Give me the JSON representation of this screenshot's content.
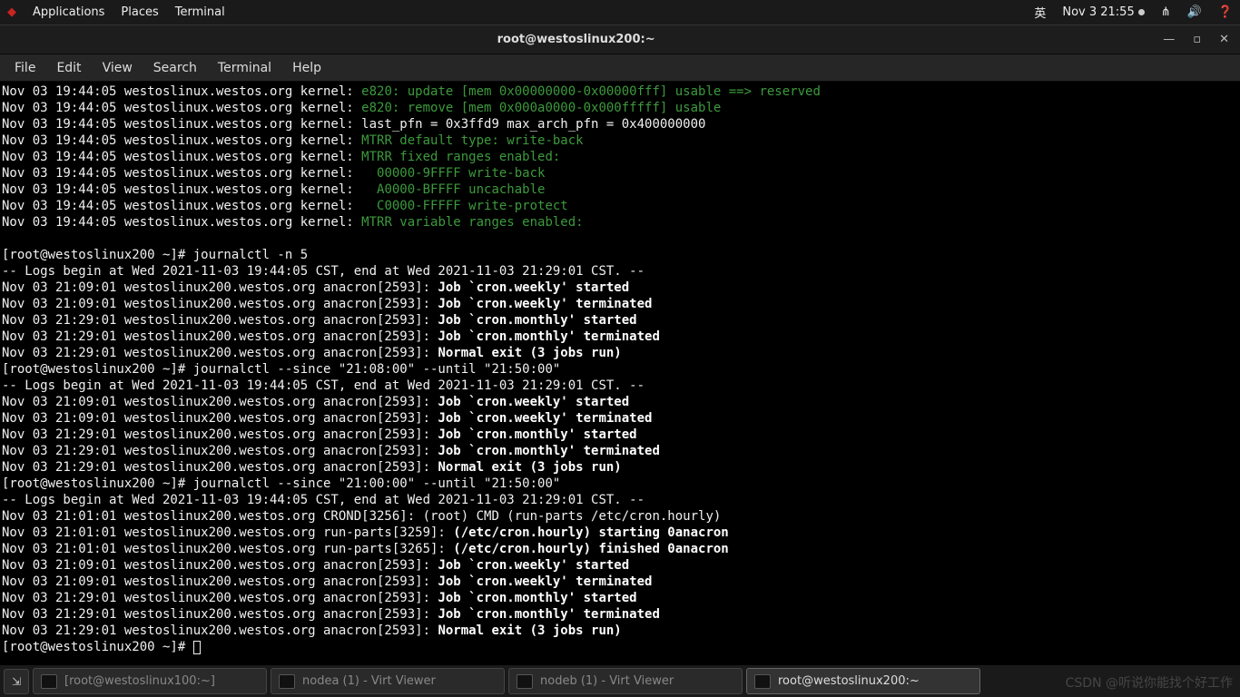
{
  "topbar": {
    "apps": "Applications",
    "places": "Places",
    "terminal": "Terminal",
    "ime": "英",
    "clock": "Nov 3  21:55"
  },
  "window": {
    "title": "root@westoslinux200:~"
  },
  "menu": {
    "file": "File",
    "edit": "Edit",
    "view": "View",
    "search": "Search",
    "terminal": "Terminal",
    "help": "Help"
  },
  "term": {
    "k_prefix": "Nov 03 19:44:05 westoslinux.westos.org kernel: ",
    "k1": "e820: update [mem 0x00000000-0x00000fff] usable ==> reserved",
    "k2": "e820: remove [mem 0x000a0000-0x000fffff] usable",
    "k3_full": "Nov 03 19:44:05 westoslinux.westos.org kernel: last_pfn = 0x3ffd9 max_arch_pfn = 0x400000000",
    "k4": "MTRR default type: write-back",
    "k5": "MTRR fixed ranges enabled:",
    "k6": "  00000-9FFFF write-back",
    "k7": "  A0000-BFFFF uncachable",
    "k8": "  C0000-FFFFF write-protect",
    "k9": "MTRR variable ranges enabled:",
    "blank": "",
    "prompt1": "[root@westoslinux200 ~]# journalctl -n 5",
    "logs_hdr": "-- Logs begin at Wed 2021-11-03 19:44:05 CST, end at Wed 2021-11-03 21:29:01 CST. --",
    "a_prefix_0901": "Nov 03 21:09:01 westoslinux200.westos.org anacron[2593]: ",
    "a_prefix_2901": "Nov 03 21:29:01 westoslinux200.westos.org anacron[2593]: ",
    "a_prefix_0101": "Nov 03 21:01:01 westoslinux200.westos.org ",
    "b_weekly_start": "Job `cron.weekly' started",
    "b_weekly_term": "Job `cron.weekly' terminated",
    "b_monthly_start": "Job `cron.monthly' started",
    "b_monthly_term": "Job `cron.monthly' terminated",
    "b_normal_exit": "Normal exit (3 jobs run)",
    "prompt2": "[root@westoslinux200 ~]# journalctl --since \"21:08:00\" --until \"21:50:00\"",
    "prompt3": "[root@westoslinux200 ~]# journalctl --since \"21:00:00\" --until \"21:50:00\"",
    "crond_line": "Nov 03 21:01:01 westoslinux200.westos.org CROND[3256]: (root) CMD (run-parts /etc/cron.hourly)",
    "rp_start_pre": "Nov 03 21:01:01 westoslinux200.westos.org run-parts[3259]: ",
    "rp_start_b": "(/etc/cron.hourly) starting 0anacron",
    "rp_fin_pre": "Nov 03 21:01:01 westoslinux200.westos.org run-parts[3265]: ",
    "rp_fin_b": "(/etc/cron.hourly) finished 0anacron",
    "prompt_empty": "[root@westoslinux200 ~]# "
  },
  "taskbar": {
    "t1": "[root@westoslinux100:~]",
    "t2": "nodea (1) - Virt Viewer",
    "t3": "nodeb (1) - Virt Viewer",
    "t4": "root@westoslinux200:~"
  },
  "watermark": "CSDN @听说你能找个好工作"
}
